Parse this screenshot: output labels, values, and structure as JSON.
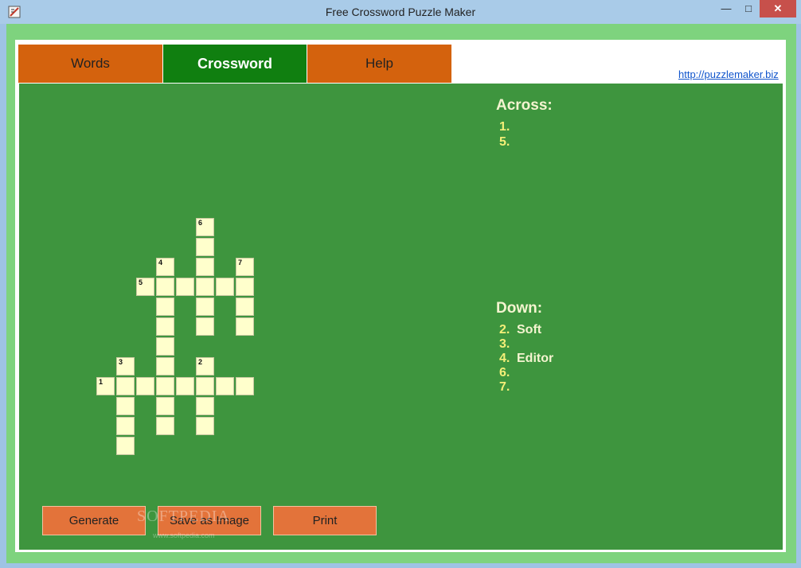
{
  "window": {
    "title": "Free Crossword Puzzle Maker",
    "minimize": "—",
    "maximize": "□",
    "close": "✕"
  },
  "tabs": {
    "words": "Words",
    "crossword": "Crossword",
    "help": "Help",
    "active": "crossword"
  },
  "link": "http://puzzlemaker.biz",
  "grid": {
    "numbers": {
      "n1": "1",
      "n2": "2",
      "n3": "3",
      "n4": "4",
      "n5": "5",
      "n6": "6",
      "n7": "7"
    }
  },
  "clues": {
    "across_heading": "Across:",
    "across": [
      {
        "num": "1.",
        "text": ""
      },
      {
        "num": "5.",
        "text": ""
      }
    ],
    "down_heading": "Down:",
    "down": [
      {
        "num": "2.",
        "text": "Soft"
      },
      {
        "num": "3.",
        "text": ""
      },
      {
        "num": "4.",
        "text": "Editor"
      },
      {
        "num": "6.",
        "text": ""
      },
      {
        "num": "7.",
        "text": ""
      }
    ]
  },
  "buttons": {
    "generate": "Generate",
    "save_image": "Save as Image",
    "print": "Print"
  },
  "watermark": {
    "main": "SOFTPEDIA",
    "sub": "www.softpedia.com"
  },
  "colors": {
    "panel": "#3e953e",
    "tab_inactive": "#d4620d",
    "tab_active": "#107f10",
    "cell": "#ffffcc",
    "button": "#e3733a"
  }
}
